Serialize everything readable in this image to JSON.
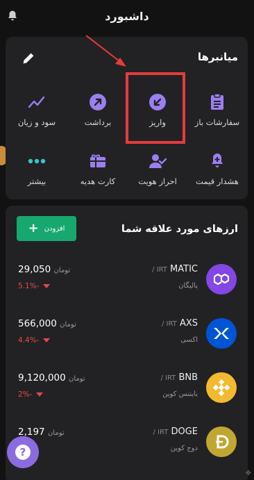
{
  "header": {
    "title": "داشبورد"
  },
  "shortcuts": {
    "title": "میانبرها",
    "items": [
      {
        "label": "سفارشات باز",
        "icon": "clipboard-icon"
      },
      {
        "label": "واریز",
        "icon": "deposit-arrow-icon"
      },
      {
        "label": "برداشت",
        "icon": "withdraw-arrow-icon"
      },
      {
        "label": "سود و زیان",
        "icon": "chart-line-icon"
      },
      {
        "label": "هشدار قیمت",
        "icon": "bell-plus-icon"
      },
      {
        "label": "احراز هویت",
        "icon": "user-check-icon"
      },
      {
        "label": "کارت هدیه",
        "icon": "gift-card-icon"
      },
      {
        "label": "بیشتر",
        "icon": "more-dots-icon"
      }
    ]
  },
  "favorites": {
    "title": "ارزهای مورد علاقه شما",
    "add_label": "افزودن",
    "coins": [
      {
        "symbol": "MATIC",
        "quote": "/ IRT",
        "name": "پالیگان",
        "price": "29,050",
        "unit": "تومان",
        "change": "5.1%-",
        "color": "#8247e5"
      },
      {
        "symbol": "AXS",
        "quote": "/ IRT",
        "name": "اکسی",
        "price": "566,000",
        "unit": "تومان",
        "change": "4.4%-",
        "color": "#0055d5"
      },
      {
        "symbol": "BNB",
        "quote": "/ IRT",
        "name": "بایننس کوین",
        "price": "9,120,000",
        "unit": "تومان",
        "change": "2%-",
        "color": "#f3ba2f"
      },
      {
        "symbol": "DOGE",
        "quote": "/ IRT",
        "name": "دوج کوین",
        "price": "2,197",
        "unit": "تومان",
        "change": "",
        "color": "#c2a633"
      }
    ]
  },
  "colors": {
    "accent": "#8b6be0",
    "green": "#17a870",
    "red": "#e5484d",
    "highlight": "#e63b3b"
  }
}
